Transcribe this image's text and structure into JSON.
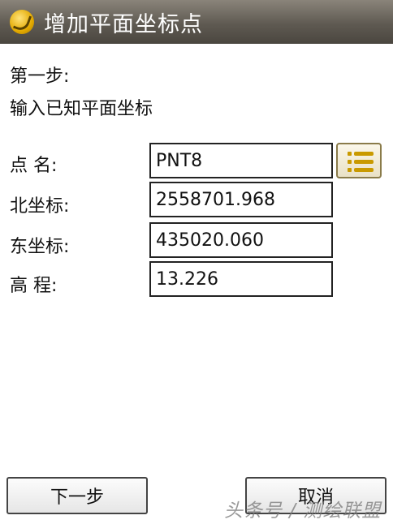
{
  "window": {
    "title": "增加平面坐标点"
  },
  "step": {
    "label": "第一步:",
    "instruction": "输入已知平面坐标"
  },
  "fields": {
    "point_name": {
      "label": "点 名:",
      "value": "PNT8"
    },
    "north": {
      "label": "北坐标:",
      "value": "2558701.968"
    },
    "east": {
      "label": "东坐标:",
      "value": "435020.060"
    },
    "elevation": {
      "label": "高 程:",
      "value": "13.226"
    }
  },
  "buttons": {
    "next_label": "下一步",
    "cancel_label": "取消"
  },
  "watermark": "头条号 / 测绘联盟",
  "icons": {
    "app": "app-logo-icon",
    "list": "list-icon"
  },
  "colors": {
    "titlebar": "#5f5a52",
    "list_icon": "#c99a00"
  }
}
